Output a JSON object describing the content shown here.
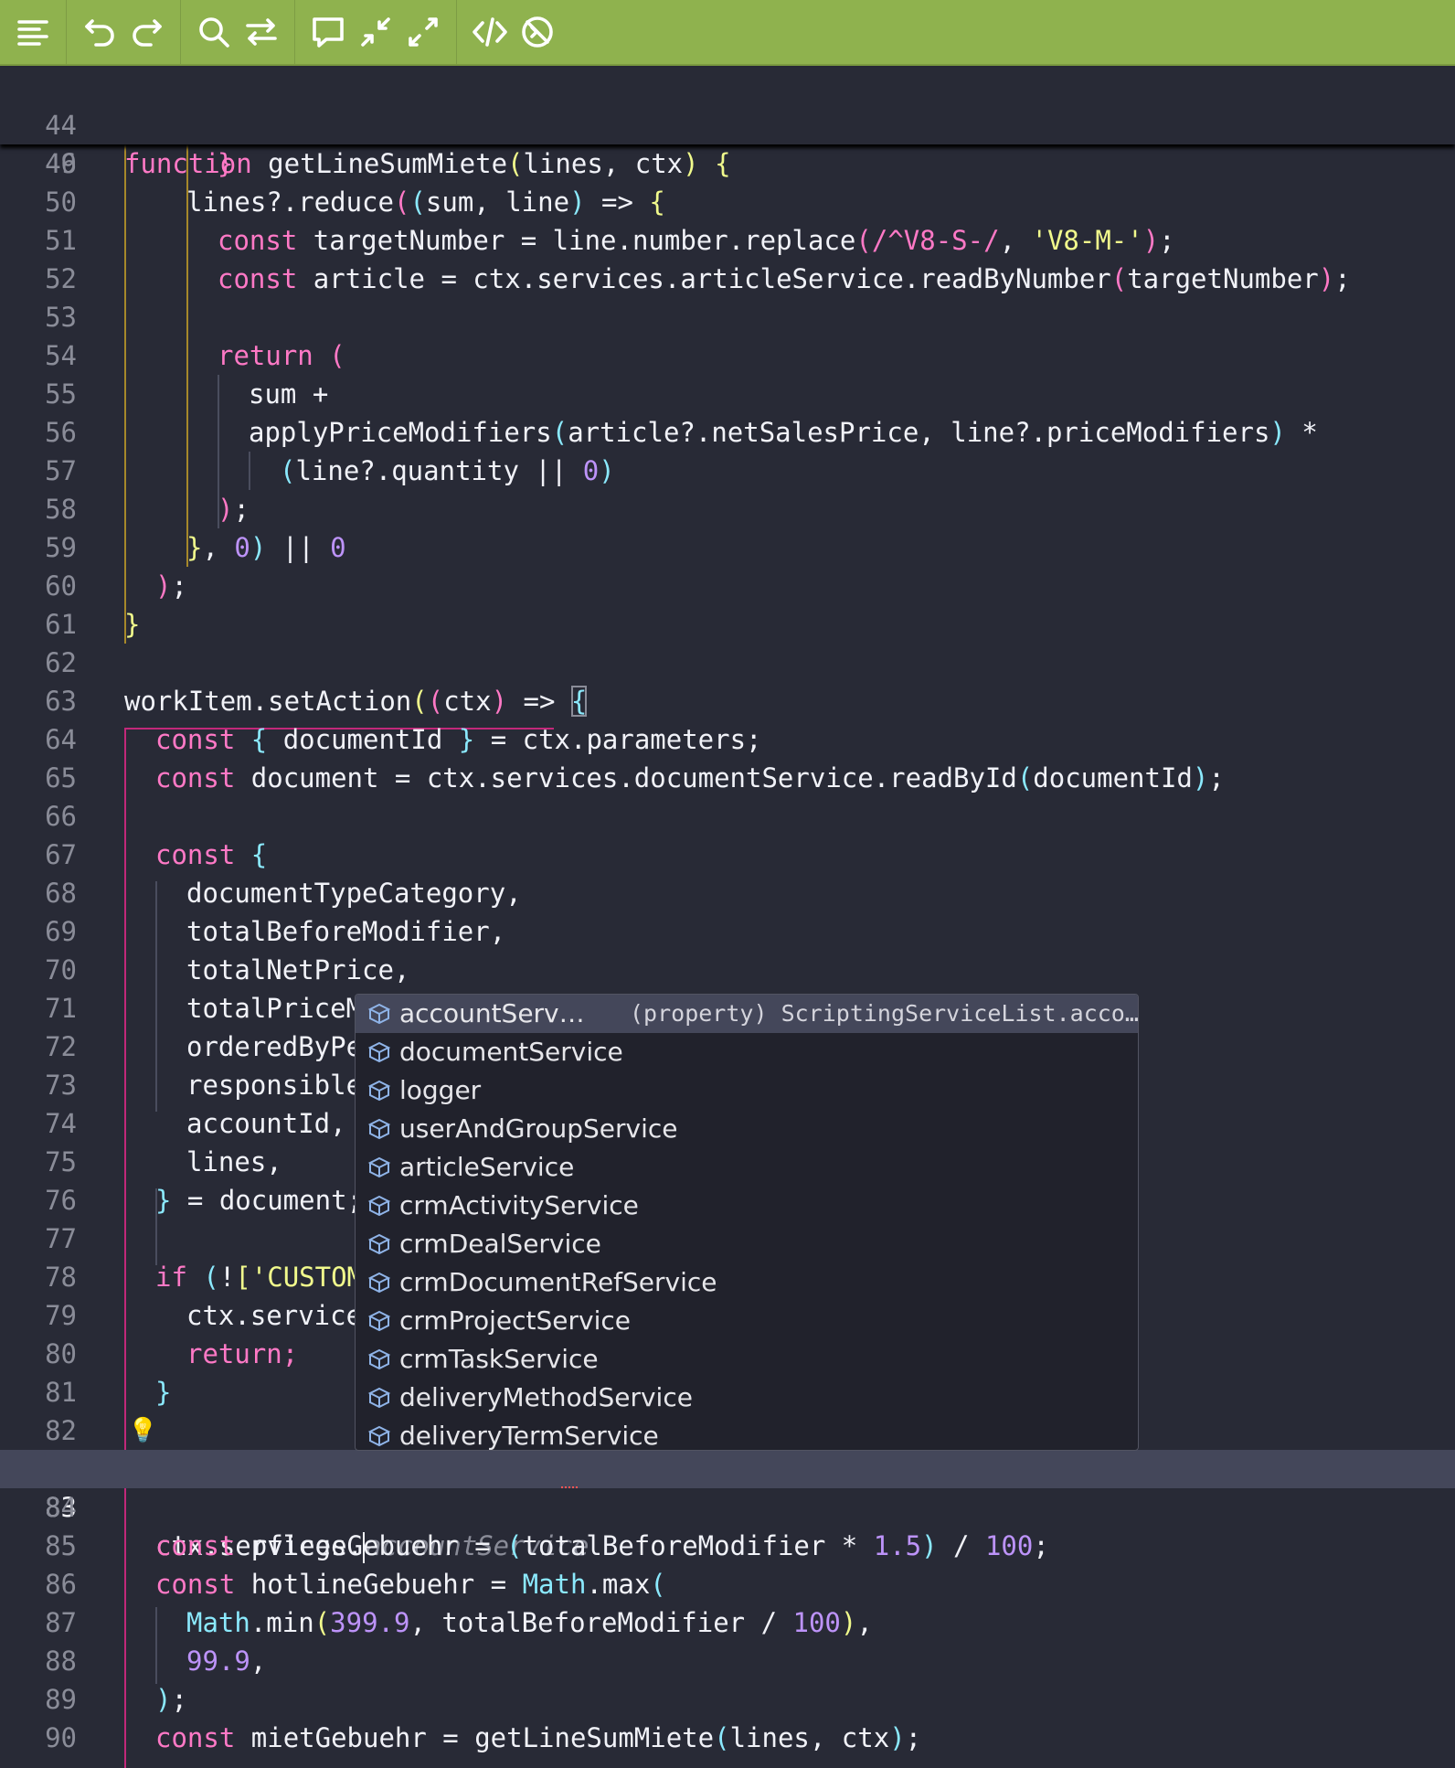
{
  "toolbar": {
    "groups": [
      [
        "menu-icon"
      ],
      [
        "undo-icon",
        "redo-icon"
      ],
      [
        "search-icon",
        "replace-icon"
      ],
      [
        "comment-icon",
        "minimize-icon",
        "maximize-icon"
      ],
      [
        "code-icon",
        "disable-icon"
      ]
    ]
  },
  "sticky_lines": [
    {
      "n": "44",
      "code": "function getLineSumMiete(lines, ctx) {"
    },
    {
      "n": "46",
      "code": "lines?.reduce((sum, line) => {"
    }
  ],
  "lines": [
    {
      "n": "49",
      "code": "}"
    },
    {
      "n": "50",
      "code": ""
    },
    {
      "n": "51",
      "code": "const targetNumber = line.number.replace(/^V8-S-/, 'V8-M-');"
    },
    {
      "n": "52",
      "code": "const article = ctx.services.articleService.readByNumber(targetNumber);"
    },
    {
      "n": "53",
      "code": ""
    },
    {
      "n": "54",
      "code": "return ("
    },
    {
      "n": "55",
      "code": "sum +"
    },
    {
      "n": "56",
      "code": "applyPriceModifiers(article?.netSalesPrice, line?.priceModifiers) *"
    },
    {
      "n": "57",
      "code": "(line?.quantity || 0)"
    },
    {
      "n": "58",
      "code": ");"
    },
    {
      "n": "59",
      "code": "}, 0) || 0"
    },
    {
      "n": "60",
      "code": ");"
    },
    {
      "n": "61",
      "code": "}"
    },
    {
      "n": "62",
      "code": ""
    },
    {
      "n": "63",
      "code": "workItem.setAction((ctx) => {"
    },
    {
      "n": "64",
      "code": "const { documentId } = ctx.parameters;"
    },
    {
      "n": "65",
      "code": "const document = ctx.services.documentService.readById(documentId);"
    },
    {
      "n": "66",
      "code": ""
    },
    {
      "n": "67",
      "code": "const {"
    },
    {
      "n": "68",
      "code": "documentTypeCategory,"
    },
    {
      "n": "69",
      "code": "totalBeforeModifier,"
    },
    {
      "n": "70",
      "code": "totalNetPrice,"
    },
    {
      "n": "71",
      "code": "totalPriceM"
    },
    {
      "n": "72",
      "code": "orderedByPe"
    },
    {
      "n": "73",
      "code": "responsible"
    },
    {
      "n": "74",
      "code": "accountId,"
    },
    {
      "n": "75",
      "code": "lines,"
    },
    {
      "n": "76",
      "code": "} = document;"
    },
    {
      "n": "77",
      "code": ""
    },
    {
      "n": "78",
      "code": "if (!['CUSTOM"
    },
    {
      "n": "79",
      "code": "ctx.service"
    },
    {
      "n": "80",
      "code": "return;"
    },
    {
      "n": "81",
      "code": "}"
    },
    {
      "n": "82",
      "code": ""
    },
    {
      "n": "83",
      "code": "ctx.services.",
      "ghost": "accountService"
    },
    {
      "n": "84",
      "code": ""
    },
    {
      "n": "85",
      "code": "const pflegeGebuehr = (totalBeforeModifier * 1.5) / 100;"
    },
    {
      "n": "86",
      "code": "const hotlineGebuehr = Math.max("
    },
    {
      "n": "87",
      "code": "Math.min(399.9, totalBeforeModifier / 100),"
    },
    {
      "n": "88",
      "code": "99.9,"
    },
    {
      "n": "89",
      "code": ");"
    },
    {
      "n": "90",
      "code": "const mietGebuehr = getLineSumMiete(lines, ctx);"
    }
  ],
  "suggest": {
    "detail": "(property) ScriptingServiceList.acco…",
    "items": [
      "accountServ…",
      "documentService",
      "logger",
      "userAndGroupService",
      "articleService",
      "crmActivityService",
      "crmDealService",
      "crmDocumentRefService",
      "crmProjectService",
      "crmTaskService",
      "deliveryMethodService",
      "deliveryTermService"
    ]
  }
}
